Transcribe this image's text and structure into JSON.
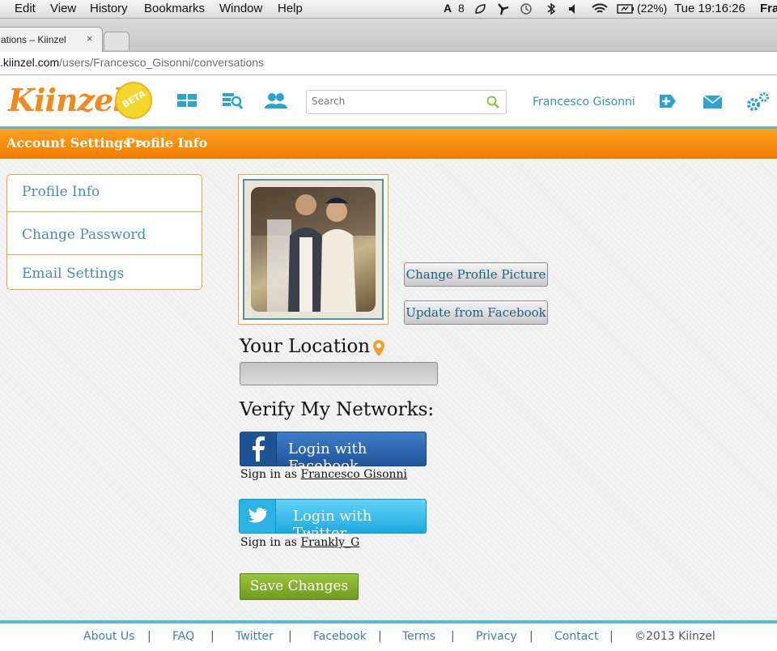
{
  "menubar": {
    "items": [
      "Edit",
      "View",
      "History",
      "Bookmarks",
      "Window",
      "Help"
    ],
    "notification_count": "8",
    "battery": "(22%)",
    "clock": "Tue 19:16:26",
    "user": "Fra"
  },
  "browser": {
    "tab_title": "ations – Kiinzel",
    "tab_close": "×",
    "url_host": ".kiinzel.com",
    "url_path": "/users/Francesco_Gisonni/conversations"
  },
  "header": {
    "logo_text": "Kiinzel",
    "beta_badge": "BETA",
    "search_placeholder": "Search",
    "user_name": "Francesco Gisonni"
  },
  "breadcrumb": {
    "parent": "Account Settings >",
    "current": "Profile Info"
  },
  "sidenav": {
    "items": [
      {
        "label": "Profile Info"
      },
      {
        "label": "Change Password"
      },
      {
        "label": "Email Settings"
      }
    ]
  },
  "profile": {
    "change_picture_label": "Change Profile Picture",
    "update_facebook_label": "Update from Facebook",
    "location_heading": "Your Location",
    "location_value": "",
    "networks_heading": "Verify My Networks:",
    "facebook_button": "Login with Facebook",
    "facebook_signin_prefix": "Sign in as",
    "facebook_signin_name": "Francesco Gisonni",
    "twitter_button": "Login with Twitter",
    "twitter_signin_prefix": "Sign in as",
    "twitter_signin_name": "Frankly_G",
    "save_label": "Save Changes"
  },
  "footer": {
    "links": [
      "About Us",
      "FAQ",
      "Twitter",
      "Facebook",
      "Terms",
      "Privacy",
      "Contact"
    ],
    "separator": "|",
    "copyright": "©2013 Kiinzel"
  },
  "colors": {
    "accent_blue": "#5bb8dc",
    "orange": "#f08a1c",
    "facebook": "#2f6cb3",
    "twitter": "#33bfee",
    "save_green": "#86b02c"
  }
}
